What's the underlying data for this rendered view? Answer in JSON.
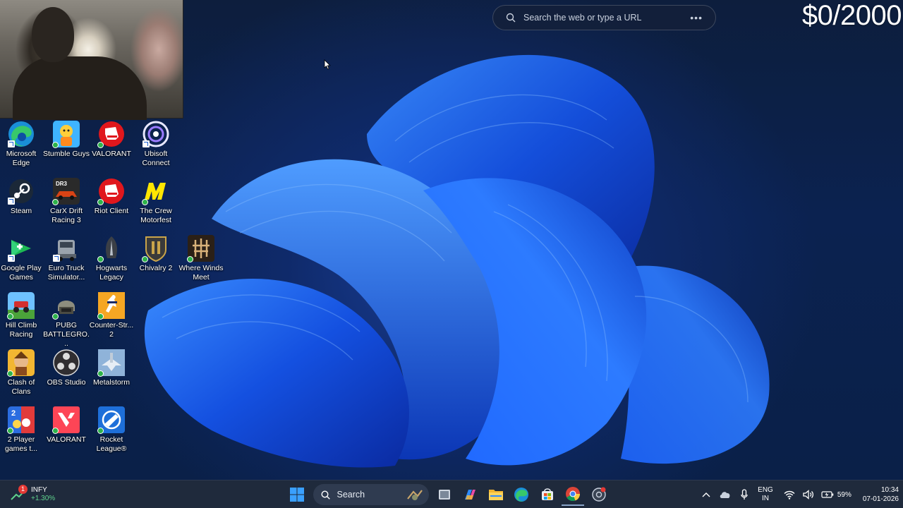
{
  "overlay": {
    "goal_text": "$0/2000"
  },
  "browser_search": {
    "placeholder": "Search the web or type a URL",
    "more_icon": "more-horizontal-icon"
  },
  "desktop_icons": [
    {
      "label": "Microsoft Edge",
      "icon": "edge-icon"
    },
    {
      "label": "Stumble Guys",
      "icon": "stumble-guys-icon"
    },
    {
      "label": "VALORANT",
      "icon": "riot-valorant-icon"
    },
    {
      "label": "Ubisoft Connect",
      "icon": "ubisoft-icon"
    },
    {
      "label": "Steam",
      "icon": "steam-icon"
    },
    {
      "label": "CarX Drift Racing 3",
      "icon": "carx-icon"
    },
    {
      "label": "Riot Client",
      "icon": "riot-client-icon"
    },
    {
      "label": "The Crew Motorfest",
      "icon": "crew-icon"
    },
    {
      "label": "Google Play Games",
      "icon": "google-play-games-icon"
    },
    {
      "label": "Euro Truck Simulator...",
      "icon": "truck-icon"
    },
    {
      "label": "Hogwarts Legacy",
      "icon": "hogwarts-icon"
    },
    {
      "label": "Chivalry 2",
      "icon": "chivalry-icon"
    },
    {
      "label": "Where Winds Meet",
      "icon": "where-winds-meet-icon"
    },
    {
      "label": "Hill Climb Racing",
      "icon": "hill-climb-icon"
    },
    {
      "label": "PUBG BATTLEGRO...",
      "icon": "pubg-icon"
    },
    {
      "label": "Counter-Str... 2",
      "icon": "counter-strike-icon"
    },
    {
      "label": "Clash of Clans",
      "icon": "clash-icon"
    },
    {
      "label": "OBS Studio",
      "icon": "obs-icon"
    },
    {
      "label": "Metalstorm",
      "icon": "metalstorm-icon"
    },
    {
      "label": "2 Player games t...",
      "icon": "two-player-icon"
    },
    {
      "label": "VALORANT",
      "icon": "valorant-icon"
    },
    {
      "label": "Rocket League®",
      "icon": "rocket-league-icon"
    }
  ],
  "taskbar": {
    "widget": {
      "symbol": "INFY",
      "change": "+1.30%",
      "badge": "1"
    },
    "search_label": "Search",
    "pinned": [
      "start-icon",
      "game-app-icon",
      "task-view-icon",
      "copilot-icon",
      "file-explorer-icon",
      "edge-icon",
      "store-icon",
      "chrome-icon",
      "chrome-recording-icon"
    ],
    "tray": {
      "lang_line1": "ENG",
      "lang_line2": "IN",
      "battery": "59%",
      "time": "10:34",
      "date": "07-01-2026"
    }
  },
  "colors": {
    "taskbar_bg": "#1f2a3c",
    "accent_blue": "#1f6fff",
    "positive_green": "#5fd38d"
  }
}
